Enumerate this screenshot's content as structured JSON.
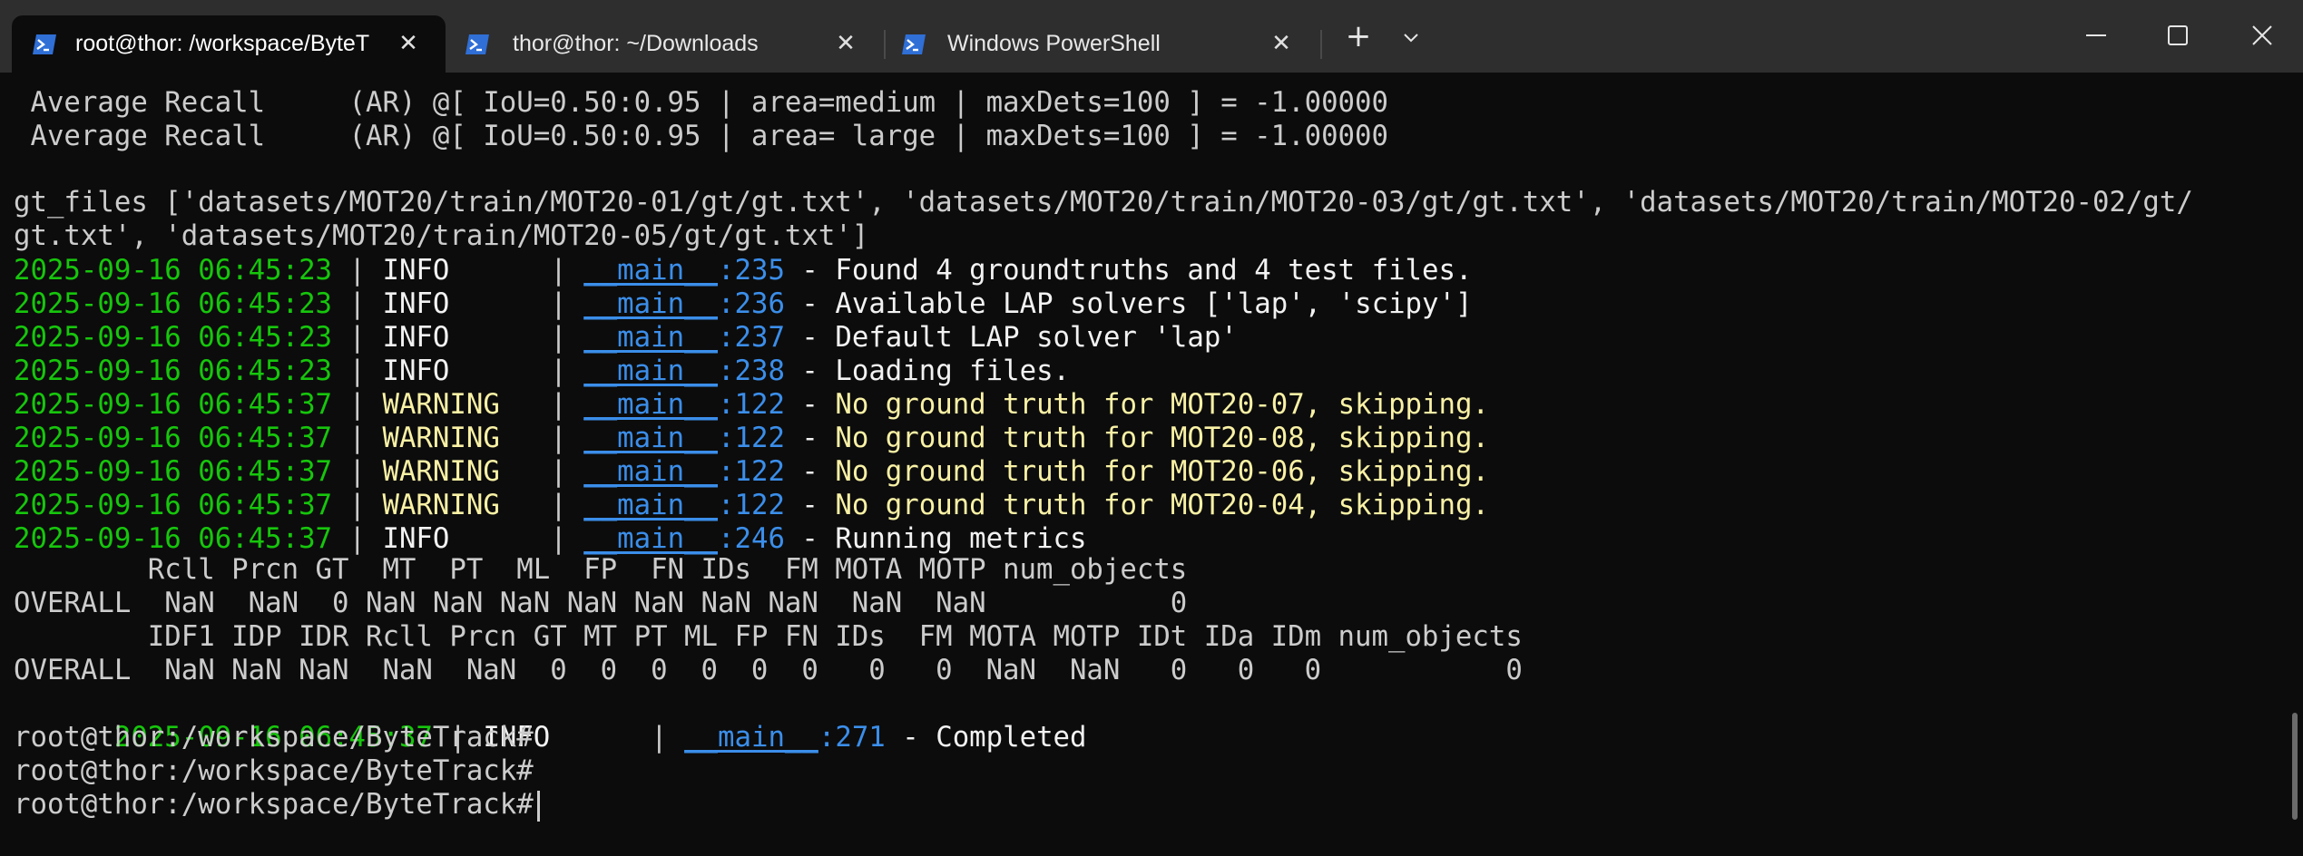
{
  "tabs": [
    {
      "label": "root@thor: /workspace/ByteT",
      "close": "✕",
      "icon": "powershell-icon"
    },
    {
      "label": "thor@thor: ~/Downloads",
      "close": "✕",
      "icon": "powershell-icon"
    },
    {
      "label": "Windows PowerShell",
      "close": "✕",
      "icon": "powershell-icon"
    }
  ],
  "toolbar": {
    "new_tab": "+",
    "dropdown": "⌄"
  },
  "window_controls": {
    "minimize": "—",
    "maximize": "☐",
    "close": "✕"
  },
  "terminal": {
    "ar_medium": " Average Recall     (AR) @[ IoU=0.50:0.95 | area=medium | maxDets=100 ] = -1.00000",
    "ar_large": " Average Recall     (AR) @[ IoU=0.50:0.95 | area= large | maxDets=100 ] = -1.00000",
    "gt_files_1": "gt_files ['datasets/MOT20/train/MOT20-01/gt/gt.txt', 'datasets/MOT20/train/MOT20-03/gt/gt.txt', 'datasets/MOT20/train/MOT20-02/gt/",
    "gt_files_2": "gt.txt', 'datasets/MOT20/train/MOT20-05/gt/gt.txt']",
    "log": [
      {
        "ts": "2025-09-16 06:45:23",
        "sep1": " | ",
        "level": "INFO     ",
        "sep2": " | ",
        "module": "__main__",
        "colon": ":",
        "line": "235",
        "dash": " - ",
        "msg": "Found 4 groundtruths and 4 test files."
      },
      {
        "ts": "2025-09-16 06:45:23",
        "sep1": " | ",
        "level": "INFO     ",
        "sep2": " | ",
        "module": "__main__",
        "colon": ":",
        "line": "236",
        "dash": " - ",
        "msg": "Available LAP solvers ['lap', 'scipy']"
      },
      {
        "ts": "2025-09-16 06:45:23",
        "sep1": " | ",
        "level": "INFO     ",
        "sep2": " | ",
        "module": "__main__",
        "colon": ":",
        "line": "237",
        "dash": " - ",
        "msg": "Default LAP solver 'lap'"
      },
      {
        "ts": "2025-09-16 06:45:23",
        "sep1": " | ",
        "level": "INFO     ",
        "sep2": " | ",
        "module": "__main__",
        "colon": ":",
        "line": "238",
        "dash": " - ",
        "msg": "Loading files."
      },
      {
        "ts": "2025-09-16 06:45:37",
        "sep1": " | ",
        "level": "WARNING  ",
        "sep2": " | ",
        "module": "__main__",
        "colon": ":",
        "line": "122",
        "dash": " - ",
        "msg": "No ground truth for MOT20-07, skipping."
      },
      {
        "ts": "2025-09-16 06:45:37",
        "sep1": " | ",
        "level": "WARNING  ",
        "sep2": " | ",
        "module": "__main__",
        "colon": ":",
        "line": "122",
        "dash": " - ",
        "msg": "No ground truth for MOT20-08, skipping."
      },
      {
        "ts": "2025-09-16 06:45:37",
        "sep1": " | ",
        "level": "WARNING  ",
        "sep2": " | ",
        "module": "__main__",
        "colon": ":",
        "line": "122",
        "dash": " - ",
        "msg": "No ground truth for MOT20-06, skipping."
      },
      {
        "ts": "2025-09-16 06:45:37",
        "sep1": " | ",
        "level": "WARNING  ",
        "sep2": " | ",
        "module": "__main__",
        "colon": ":",
        "line": "122",
        "dash": " - ",
        "msg": "No ground truth for MOT20-04, skipping."
      },
      {
        "ts": "2025-09-16 06:45:37",
        "sep1": " | ",
        "level": "INFO     ",
        "sep2": " | ",
        "module": "__main__",
        "colon": ":",
        "line": "246",
        "dash": " - ",
        "msg": "Running metrics"
      }
    ],
    "table1_header": "        Rcll Prcn GT  MT  PT  ML  FP  FN IDs  FM MOTA MOTP num_objects",
    "table1_row": "OVERALL  NaN  NaN  0 NaN NaN NaN NaN NaN NaN NaN  NaN  NaN           0",
    "table2_header": "        IDF1 IDP IDR Rcll Prcn GT MT PT ML FP FN IDs  FM MOTA MOTP IDt IDa IDm num_objects",
    "table2_row": "OVERALL  NaN NaN NaN  NaN  NaN  0  0  0  0  0  0   0   0  NaN  NaN   0   0   0           0",
    "log_final": {
      "ts": "2025-09-16 06:45:37",
      "sep1": " | ",
      "level": "INFO     ",
      "sep2": " | ",
      "module": "__main__",
      "colon": ":",
      "line": "271",
      "dash": " - ",
      "msg": "Completed"
    },
    "prompts": [
      "root@thor:/workspace/ByteTrack#",
      "root@thor:/workspace/ByteTrack#",
      "root@thor:/workspace/ByteTrack#"
    ]
  },
  "colors": {
    "timestamp": "#16c60c",
    "warning": "#f9f1a5",
    "module": "#3b8eea",
    "text": "#cccccc",
    "background": "#0c0c0c",
    "titlebar": "#2e2e2e"
  }
}
